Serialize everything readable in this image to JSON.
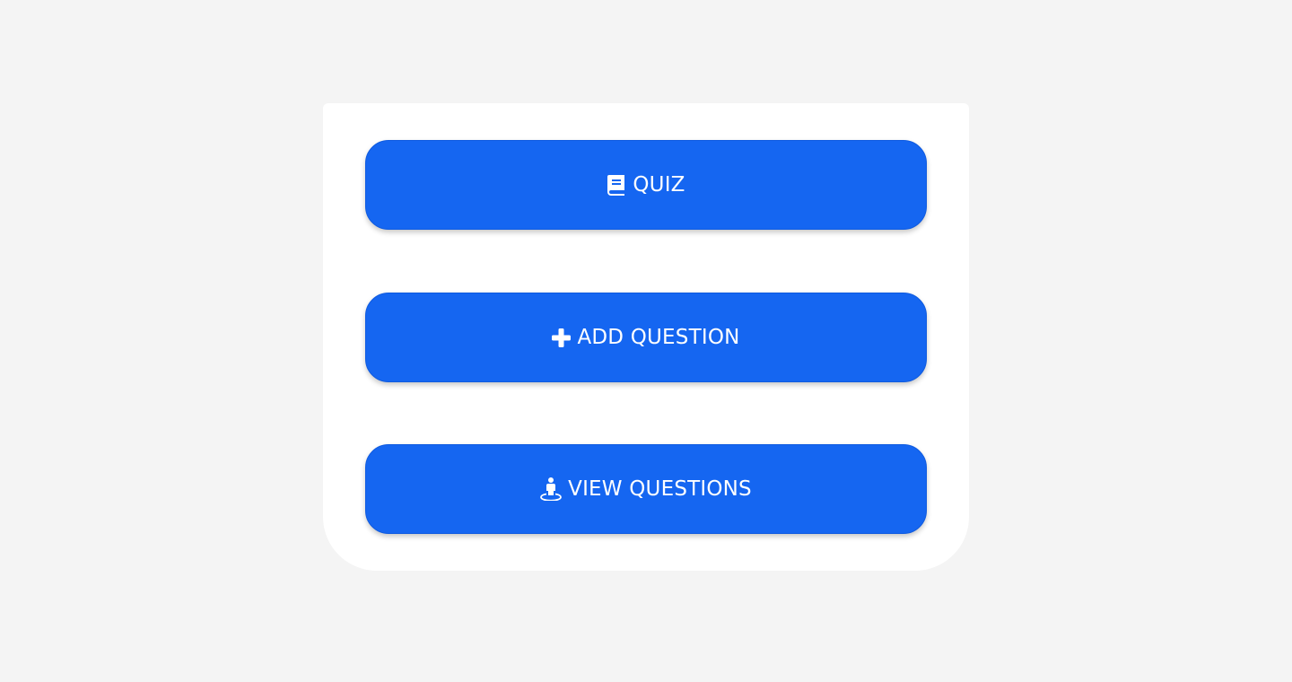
{
  "colors": {
    "page_background": "#f4f4f4",
    "card_background": "#ffffff",
    "button_background": "#1566f1",
    "button_text": "#ffffff"
  },
  "menu": {
    "buttons": [
      {
        "label": "QUIZ",
        "icon": "book-icon"
      },
      {
        "label": "ADD QUESTION",
        "icon": "plus-icon"
      },
      {
        "label": "VIEW QUESTIONS",
        "icon": "street-view-icon"
      }
    ]
  }
}
